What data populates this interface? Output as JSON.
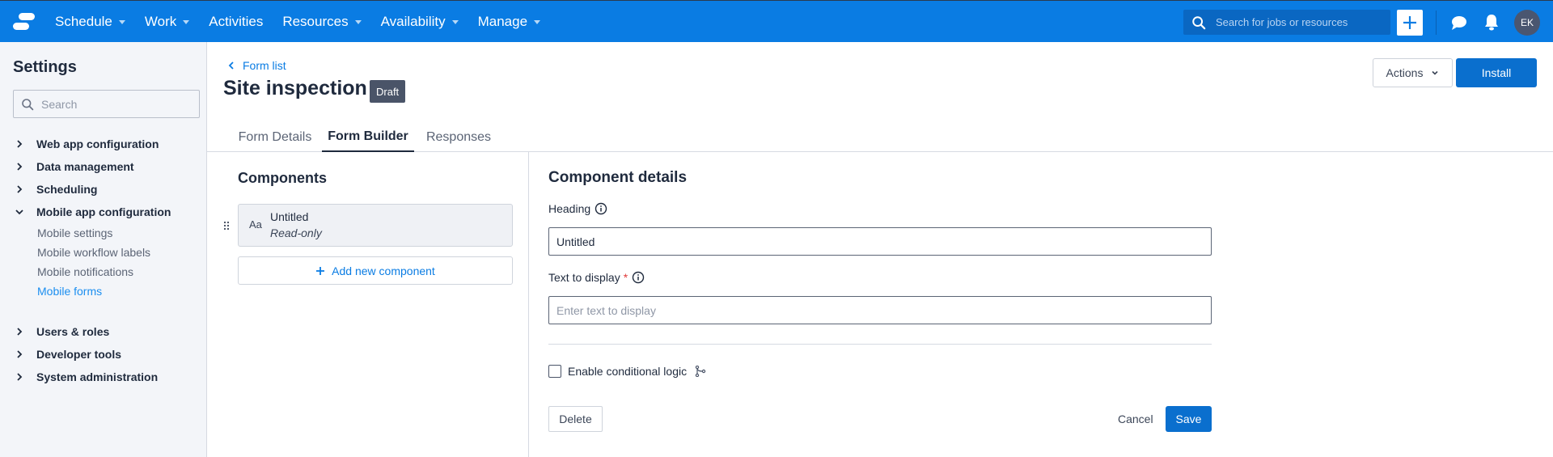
{
  "topnav": {
    "brand_icon": "app-logo",
    "items": [
      {
        "label": "Schedule",
        "has_dropdown": true
      },
      {
        "label": "Work",
        "has_dropdown": true
      },
      {
        "label": "Activities",
        "has_dropdown": false
      },
      {
        "label": "Resources",
        "has_dropdown": true
      },
      {
        "label": "Availability",
        "has_dropdown": true
      },
      {
        "label": "Manage",
        "has_dropdown": true
      }
    ],
    "search_placeholder": "Search for jobs or resources",
    "add_icon": "plus-icon",
    "chat_icon": "chat-bubble-icon",
    "notifications_icon": "bell-icon",
    "avatar_initials": "EK"
  },
  "sidebar": {
    "title": "Settings",
    "search_placeholder": "Search",
    "sections": [
      {
        "label": "Web app configuration",
        "expanded": false
      },
      {
        "label": "Data management",
        "expanded": false
      },
      {
        "label": "Scheduling",
        "expanded": false
      },
      {
        "label": "Mobile app configuration",
        "expanded": true,
        "children": [
          {
            "label": "Mobile settings",
            "active": false
          },
          {
            "label": "Mobile workflow labels",
            "active": false
          },
          {
            "label": "Mobile notifications",
            "active": false
          },
          {
            "label": "Mobile forms",
            "active": true
          }
        ]
      },
      {
        "label": "Users & roles",
        "expanded": false
      },
      {
        "label": "Developer tools",
        "expanded": false
      },
      {
        "label": "System administration",
        "expanded": false
      }
    ]
  },
  "header": {
    "breadcrumb": "Form list",
    "title": "Site inspection",
    "status_badge": "Draft",
    "actions_label": "Actions",
    "install_label": "Install"
  },
  "tabs": [
    {
      "label": "Form Details",
      "active": false
    },
    {
      "label": "Form Builder",
      "active": true
    },
    {
      "label": "Responses",
      "active": false
    }
  ],
  "components_panel": {
    "title": "Components",
    "items": [
      {
        "type_icon": "Aa",
        "name": "Untitled",
        "subtitle": "Read-only"
      }
    ],
    "add_label": "Add new component"
  },
  "details_panel": {
    "title": "Component details",
    "heading_label": "Heading",
    "heading_value": "Untitled",
    "text_label": "Text to display",
    "text_required_mark": "*",
    "text_placeholder": "Enter text to display",
    "text_value": "",
    "conditional_logic_label": "Enable conditional logic",
    "conditional_logic_checked": false,
    "delete_label": "Delete",
    "cancel_label": "Cancel",
    "save_label": "Save"
  },
  "colors": {
    "topbar": "#0a7ce3",
    "primary_button": "#0a6fce",
    "link": "#0a7ce3",
    "active_sidebar": "#1b8ef0",
    "badge": "#4a5468",
    "required": "#e03a3a"
  }
}
